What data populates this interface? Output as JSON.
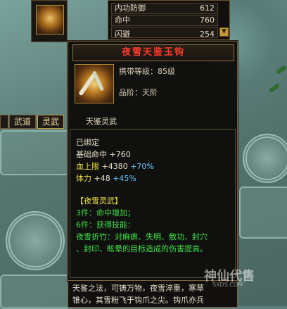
{
  "equipment_slot": {
    "icon": "weapon-icon"
  },
  "stats_panel": {
    "rows": [
      {
        "name": "内功防御",
        "value": "612"
      },
      {
        "name": "命中",
        "value": "760"
      },
      {
        "name": "闪避",
        "value": "254"
      }
    ]
  },
  "tabs": [
    {
      "label": "武道"
    },
    {
      "label": "灵武"
    }
  ],
  "tooltip": {
    "title": "夜雪天鉴玉钩",
    "carry_level": "携带等级：85级",
    "quality": "品阶：天阶",
    "subtitle": "天鉴灵武",
    "bound": "已绑定",
    "base_hit_label": "基础命中",
    "base_hit_value": "+760",
    "hp_label": "血上限",
    "hp_value": "+4380",
    "hp_pct": "+70%",
    "stamina_label": "体力",
    "stamina_value": "+48",
    "stamina_pct": "+45%",
    "set_name": "【夜雪灵武】",
    "set_3": "3件：命中增加；",
    "set_6": "6件：获得技能：",
    "skill_1": "夜雪折竹：对麻痹、失明、散功、封穴",
    "skill_2": "、封印、眩晕的目标造成的伤害提高。"
  },
  "description": {
    "line1": "天鉴之法，可铸万物，夜雪淬重，寒草",
    "line2": "锥心，其雪粉飞于钩爪之尖。钩爪亦兵"
  },
  "watermark": {
    "text": "神仙代售",
    "sub": "SXDS.COM"
  },
  "colors": {
    "title_red": "#ff3a2a",
    "set_yellow": "#f2e24a",
    "set_green": "#3fe04a",
    "bonus_blue": "#65c9ff"
  }
}
